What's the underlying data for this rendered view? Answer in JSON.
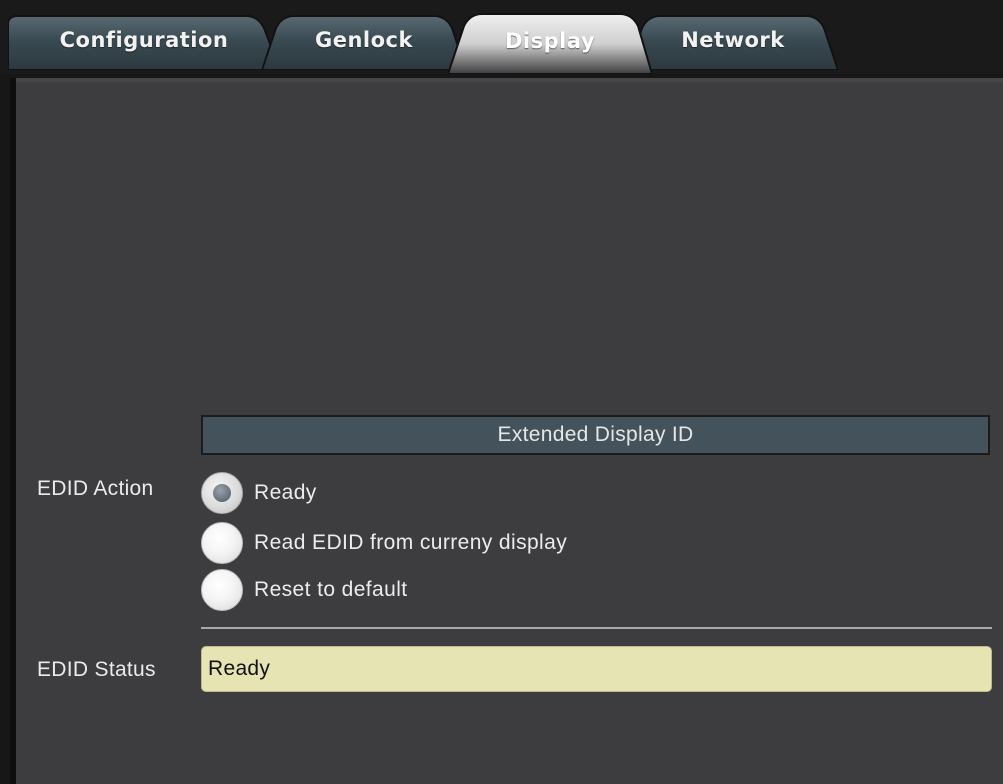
{
  "tabs": [
    {
      "label": "Configuration",
      "active": false
    },
    {
      "label": "Genlock",
      "active": false
    },
    {
      "label": "Display",
      "active": true
    },
    {
      "label": "Network",
      "active": false
    }
  ],
  "section": {
    "title": "Extended Display ID"
  },
  "edid_action": {
    "label": "EDID Action",
    "options": [
      {
        "label": "Ready",
        "selected": true
      },
      {
        "label": "Read EDID from curreny display",
        "selected": false
      },
      {
        "label": "Reset to default",
        "selected": false
      }
    ]
  },
  "edid_status": {
    "label": "EDID Status",
    "value": "Ready"
  },
  "colors": {
    "panel_bg": "#3d3d3f",
    "tab_inactive": "#3a4a52",
    "tab_active": "#d9d9d9",
    "section_header_bg": "#44535b",
    "status_bg": "#e6e4b3"
  }
}
